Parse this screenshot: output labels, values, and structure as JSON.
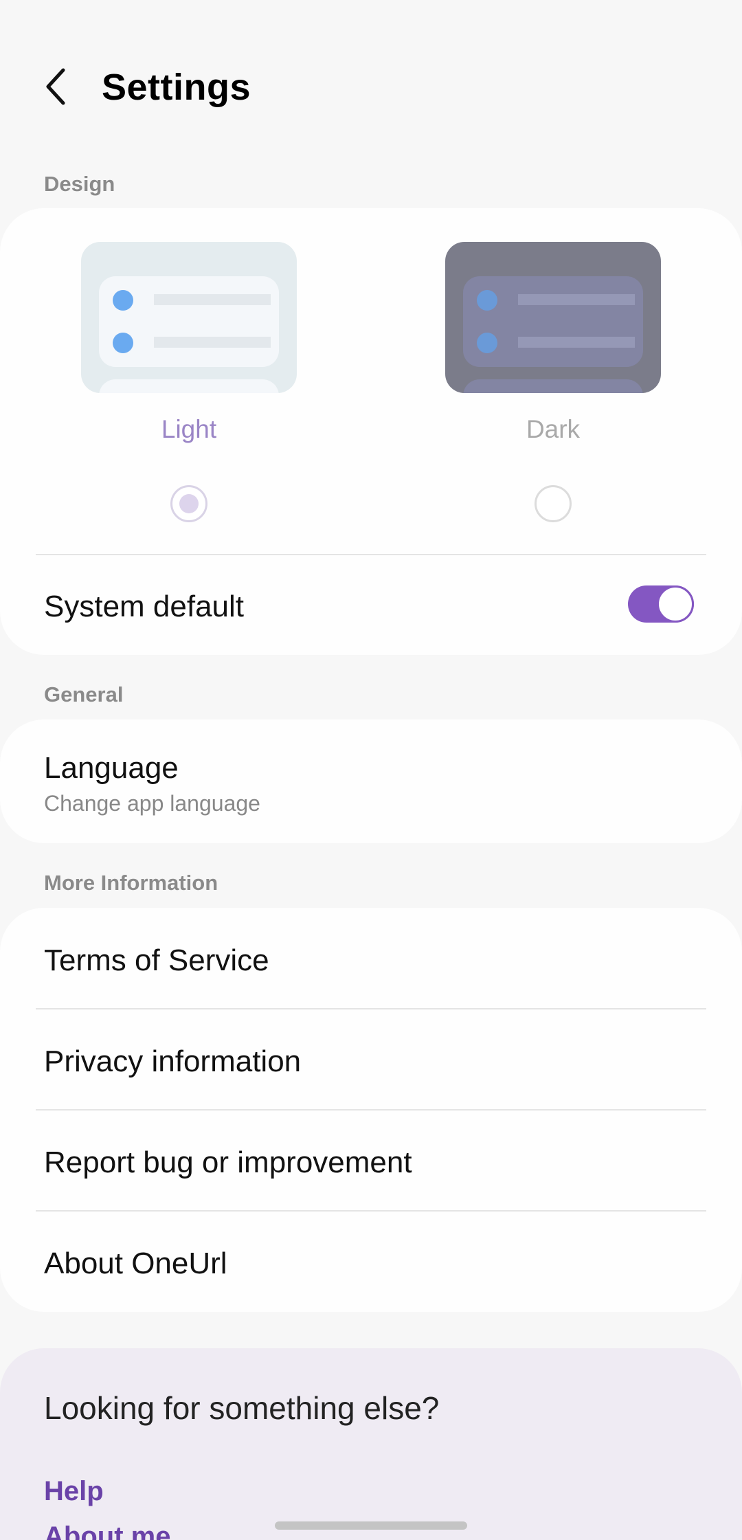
{
  "header": {
    "title": "Settings"
  },
  "design": {
    "section_label": "Design",
    "light_label": "Light",
    "dark_label": "Dark",
    "selected": "Light",
    "system_default_label": "System default",
    "system_default_on": true
  },
  "general": {
    "section_label": "General",
    "language_label": "Language",
    "language_sub": "Change app language"
  },
  "more_info": {
    "section_label": "More Information",
    "items": [
      {
        "label": "Terms of Service"
      },
      {
        "label": "Privacy information"
      },
      {
        "label": "Report bug or improvement"
      },
      {
        "label": "About OneUrl"
      }
    ]
  },
  "help": {
    "title": "Looking for something else?",
    "links": [
      "Help",
      "About me"
    ]
  },
  "colors": {
    "accent": "#8457c2",
    "link": "#6a42a8",
    "light_label": "#9a85c6",
    "dark_label": "#a9a9a9"
  }
}
